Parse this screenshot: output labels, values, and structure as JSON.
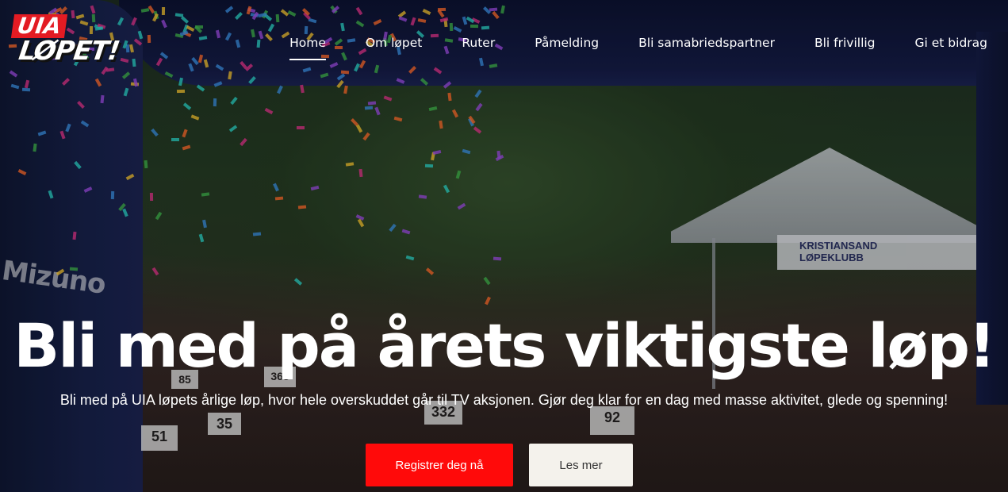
{
  "brand": {
    "logo_line1": "UIA",
    "logo_line2": "LØPET!",
    "accent_color": "#ff0a0a"
  },
  "nav": {
    "items": [
      {
        "label": "Home",
        "active": true
      },
      {
        "label": "Om løpet",
        "active": false
      },
      {
        "label": "Ruter",
        "active": false
      },
      {
        "label": "Påmelding",
        "active": false
      },
      {
        "label": "Bli samabriedspartner",
        "active": false
      },
      {
        "label": "Bli frivillig",
        "active": false
      },
      {
        "label": "Gi et bidrag",
        "active": false
      }
    ]
  },
  "hero": {
    "title": "Bli med på årets viktigste løp!",
    "subtitle": "Bli med på UIA løpets årlige løp, hvor hele overskuddet går til TV aksjonen. Gjør deg klar for en dag med masse aktivitet, glede og spenning!",
    "primary_button": "Registrer deg nå",
    "secondary_button": "Les mer",
    "photo": {
      "arch_print": "Mizuno",
      "tent_banner_line1": "KRISTIANSAND",
      "tent_banner_line2": "LØPEKLUBB",
      "bibs": [
        "51",
        "35",
        "368",
        "85",
        "332",
        "92"
      ]
    }
  }
}
